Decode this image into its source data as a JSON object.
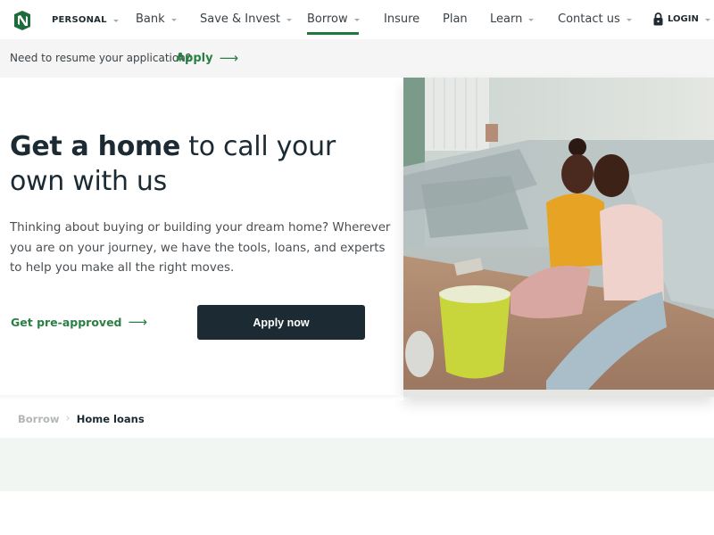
{
  "nav": {
    "segment": "PERSONAL",
    "items": [
      {
        "label": "Bank",
        "has_dropdown": true
      },
      {
        "label": "Save & Invest",
        "has_dropdown": true
      },
      {
        "label": "Borrow",
        "has_dropdown": true,
        "active": true
      },
      {
        "label": "Insure",
        "has_dropdown": false
      },
      {
        "label": "Plan",
        "has_dropdown": false
      },
      {
        "label": "Learn",
        "has_dropdown": true
      },
      {
        "label": "Contact us",
        "has_dropdown": true
      }
    ],
    "login": "LOGIN",
    "icons": {
      "logo": "nedbank-logo",
      "login": "lock-icon",
      "dropdown": "caret-down-icon"
    }
  },
  "resume_bar": {
    "text": "Need to resume your application?",
    "link": "Apply",
    "link_icon": "arrow-right-icon"
  },
  "hero": {
    "title_bold": "Get a home",
    "title_rest": " to call your own with us",
    "description": "Thinking about buying or building your dream home? Wherever you are on your journey, we have the tools, loans, and experts to help you make all the right moves.",
    "secondary_link": "Get pre-approved",
    "secondary_icon": "arrow-right-icon",
    "primary_button": "Apply now",
    "image_alt": "Couple sitting on floor near covered sofa with paint bucket"
  },
  "breadcrumb": {
    "parent": "Borrow",
    "separator_icon": "chevron-right-icon",
    "current": "Home loans"
  },
  "colors": {
    "brand_green": "#1e7a3c",
    "link_green": "#2a7f45",
    "dark": "#1b2a33",
    "resume_bg": "#f5f5f5",
    "mint_band": "#f1f6f2"
  }
}
